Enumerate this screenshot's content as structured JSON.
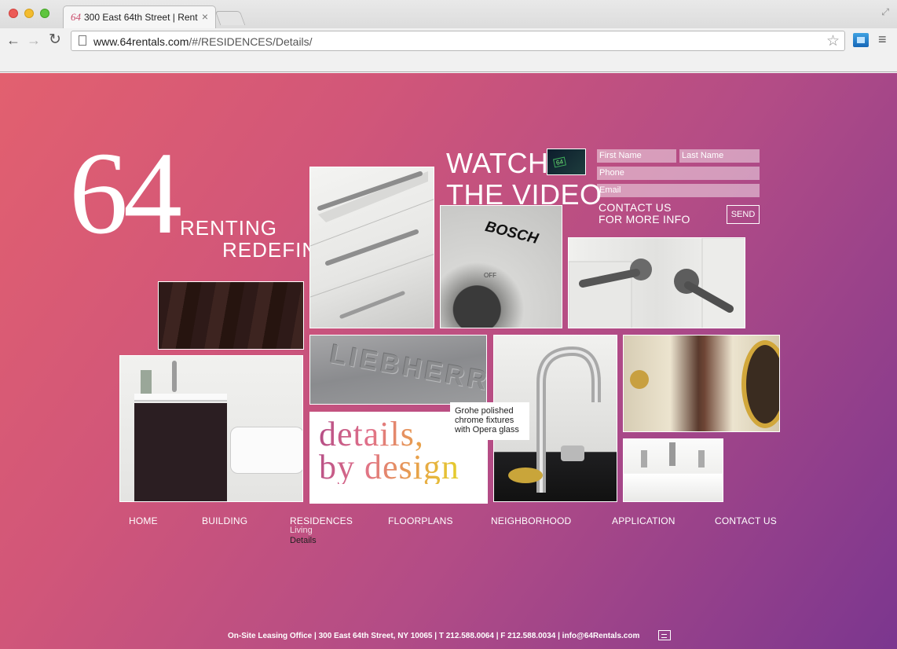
{
  "browser": {
    "tab_title": "300 East 64th Street | Rent",
    "tab_favicon": "64",
    "url_domain": "www.64rentals.com",
    "url_path": "/#/RESIDENCES/Details/"
  },
  "logo": {
    "number": "64",
    "tagline_line1": "RENTING",
    "tagline_line2": "REDEFINED"
  },
  "video": {
    "line1": "WATCH",
    "line2": "THE VIDEO",
    "thumb_label": "64"
  },
  "contact_form": {
    "first_name_placeholder": "First Name",
    "last_name_placeholder": "Last Name",
    "phone_placeholder": "Phone",
    "email_placeholder": "Email",
    "cta_line1": "CONTACT US",
    "cta_line2": "FOR MORE INFO",
    "send_label": "SEND"
  },
  "caption": "Grohe polished chrome fixtures with Opera glass",
  "details_card": {
    "line1": "details,",
    "line2": "by design"
  },
  "nav": {
    "items": [
      {
        "label": "HOME"
      },
      {
        "label": "BUILDING"
      },
      {
        "label": "RESIDENCES"
      },
      {
        "label": "FLOORPLANS"
      },
      {
        "label": "NEIGHBORHOOD"
      },
      {
        "label": "APPLICATION"
      },
      {
        "label": "CONTACT US"
      }
    ],
    "residences_sub": [
      "Living",
      "Details"
    ]
  },
  "footer": "On-Site Leasing Office | 300 East 64th Street, NY 10065 | T 212.588.0064 | F 212.588.0034 | info@64Rentals.com",
  "colors": {
    "gradient_start": "#e2606f",
    "gradient_end": "#7b368f",
    "accent": "#b34c86"
  }
}
